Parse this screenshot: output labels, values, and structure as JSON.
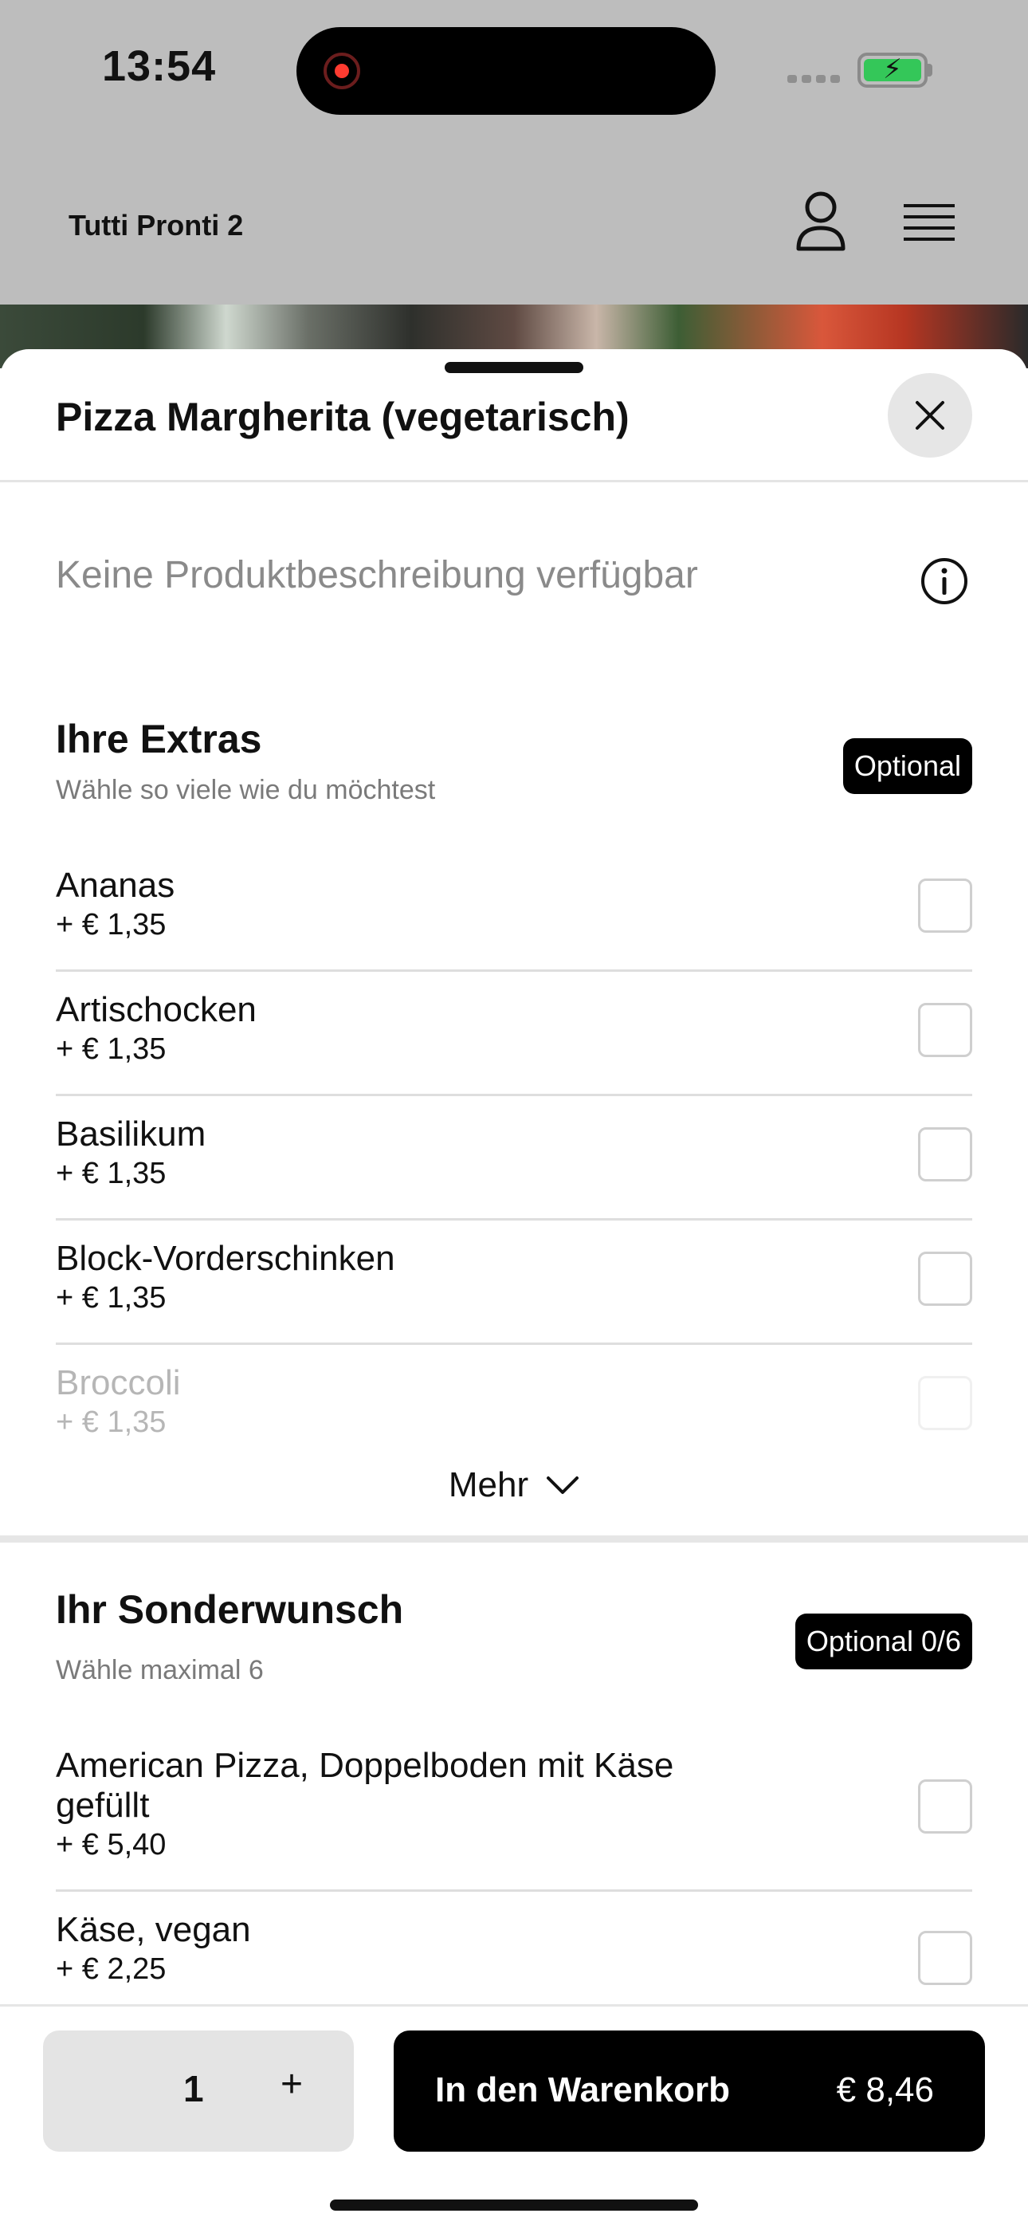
{
  "status_bar": {
    "time": "13:54"
  },
  "app": {
    "title": "Tutti Pronti 2",
    "icons": [
      "user-icon",
      "menu-icon"
    ]
  },
  "sheet": {
    "title": "Pizza Margherita (vegetarisch)",
    "description": "Keine Produktbeschreibung verfügbar"
  },
  "extras": {
    "title": "Ihre Extras",
    "subtitle": "Wähle so viele wie du möchtest",
    "badge": "Optional",
    "items": [
      {
        "name": "Ananas",
        "price": "+ € 1,35"
      },
      {
        "name": "Artischocken",
        "price": "+ € 1,35"
      },
      {
        "name": "Basilikum",
        "price": "+ € 1,35"
      },
      {
        "name": "Block-Vorderschinken",
        "price": "+ € 1,35"
      },
      {
        "name": "Broccoli",
        "price": "+ € 1,35"
      }
    ],
    "more_label": "Mehr"
  },
  "special": {
    "title": "Ihr Sonderwunsch",
    "subtitle": "Wähle maximal 6",
    "badge": "Optional 0/6",
    "items": [
      {
        "name": "American Pizza, Doppelboden mit Käse gefüllt",
        "price": "+ € 5,40"
      },
      {
        "name": "Käse, vegan",
        "price": "+ € 2,25"
      }
    ]
  },
  "bottom": {
    "quantity": "1",
    "plus": "+",
    "cart_label": "In den Warenkorb",
    "cart_price": "€ 8,46"
  },
  "colors": {
    "accent": "#000000",
    "battery": "#34c759",
    "recording": "#ff3b30"
  }
}
